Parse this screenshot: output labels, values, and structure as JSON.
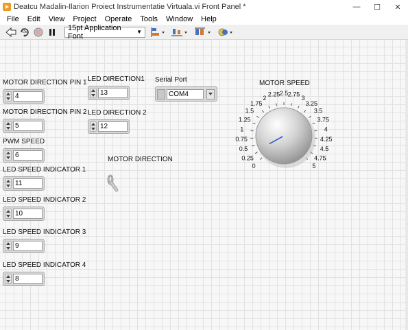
{
  "window": {
    "title": "Deatcu Madalin-Ilarion Proiect Instrumentatie Virtuala.vi Front Panel *"
  },
  "menu": [
    "File",
    "Edit",
    "View",
    "Project",
    "Operate",
    "Tools",
    "Window",
    "Help"
  ],
  "toolbar": {
    "font": "15pt Application Font"
  },
  "controls": {
    "motor_dir_pin1": {
      "label": "MOTOR DIRECTION PIN 1",
      "value": "4"
    },
    "motor_dir_pin2": {
      "label": "MOTOR DIRECTION PIN 2",
      "value": "5"
    },
    "pwm_speed": {
      "label": "PWM SPEED",
      "value": "6"
    },
    "led_speed_1": {
      "label": "LED SPEED INDICATOR  1",
      "value": "11"
    },
    "led_speed_2": {
      "label": "LED SPEED INDICATOR  2",
      "value": "10"
    },
    "led_speed_3": {
      "label": "LED SPEED INDICATOR  3",
      "value": "9"
    },
    "led_speed_4": {
      "label": "LED SPEED INDICATOR  4",
      "value": "8"
    },
    "led_dir_1": {
      "label": "LED DIRECTION1",
      "value": "13"
    },
    "led_dir_2": {
      "label": "LED DIRECTION 2",
      "value": "12"
    },
    "serial_port": {
      "label": "Serial Port",
      "value": "COM4"
    },
    "motor_direction": {
      "label": "MOTOR DIRECTION"
    },
    "motor_speed": {
      "label": "MOTOR SPEED",
      "min": 0,
      "max": 5,
      "value": 0.3,
      "ticks": [
        "0",
        "0.25",
        "0.5",
        "0.75",
        "1",
        "1.25",
        "1.5",
        "1.75",
        "2",
        "2.25",
        "2.5",
        "2.75",
        "3",
        "3.25",
        "3.5",
        "3.75",
        "4",
        "4.25",
        "4.5",
        "4.75",
        "5"
      ]
    }
  },
  "colors": {
    "accent": "#f09c1a",
    "knob_needle": "#2a58c8"
  }
}
